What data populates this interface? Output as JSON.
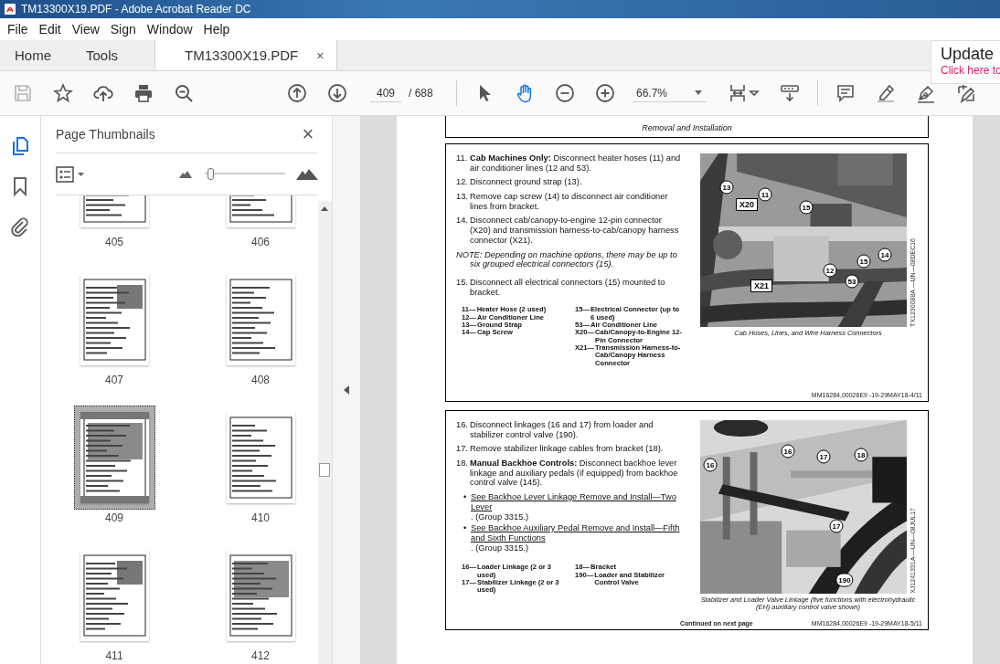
{
  "window": {
    "title": "TM13300X19.PDF - Adobe Acrobat Reader DC"
  },
  "menu": [
    "File",
    "Edit",
    "View",
    "Sign",
    "Window",
    "Help"
  ],
  "tabs": [
    {
      "label": "Home",
      "selected": false
    },
    {
      "label": "Tools",
      "selected": false
    },
    {
      "label": "TM13300X19.PDF",
      "selected": true,
      "close": "×"
    }
  ],
  "update_popup": {
    "title": "Update",
    "link": "Click here to"
  },
  "toolbar": {
    "save": {
      "disabled": true
    },
    "page_number": "409",
    "page_count": "/ 688",
    "pointer_tools": [
      {
        "kind": "select",
        "selected": false
      },
      {
        "kind": "hand",
        "selected": true
      }
    ],
    "zoom": "66.7%"
  },
  "sidebar": {
    "rail": [
      {
        "kind": "pages",
        "selected": true
      },
      {
        "kind": "bookmarks",
        "selected": false
      },
      {
        "kind": "attachments",
        "selected": false
      }
    ],
    "title": "Page Thumbnails",
    "close": "×",
    "thumbnail_size": {
      "level": 0.03
    },
    "thumbnails": [
      {
        "label": "405",
        "selected": false
      },
      {
        "label": "406",
        "selected": false
      },
      {
        "label": "407",
        "selected": false
      },
      {
        "label": "408",
        "selected": false
      },
      {
        "label": "409",
        "selected": true
      },
      {
        "label": "410",
        "selected": false
      },
      {
        "label": "411",
        "selected": false
      },
      {
        "label": "412",
        "selected": false
      }
    ]
  },
  "document": {
    "header": "Removal and Installation",
    "sections": [
      {
        "items": [
          {
            "kind": "step",
            "number": "11.",
            "text": "**Cab Machines Only:** Disconnect heater hoses (11) and air conditioner lines (12 and 53)."
          },
          {
            "kind": "step",
            "number": "12.",
            "text": "Disconnect ground strap (13)."
          },
          {
            "kind": "step",
            "number": "13.",
            "text": "Remove cap screw (14) to disconnect air conditioner lines from bracket."
          },
          {
            "kind": "step",
            "number": "14.",
            "text": "Disconnect cab/canopy-to-engine 12-pin connector (X20) and transmission harness-to-cab/canopy harness connector (X21)."
          },
          {
            "kind": "note",
            "text": "NOTE: Depending on machine options, there may be up to six grouped electrical connectors (15)."
          },
          {
            "kind": "step",
            "number": "15.",
            "text": "Disconnect all electrical connectors (15) mounted to bracket."
          }
        ],
        "legend": [
          [
            {
              "key": "11—",
              "text": "Heater Hose (2 used)"
            },
            {
              "key": "12—",
              "text": "Air Conditioner Line"
            },
            {
              "key": "13—",
              "text": "Ground Strap"
            },
            {
              "key": "14—",
              "text": "Cap Screw"
            }
          ],
          [
            {
              "key": "15—",
              "text": "Electrical Connector (up to 6 used)"
            },
            {
              "key": "53—",
              "text": "Air Conditioner Line"
            },
            {
              "key": "X20—",
              "text": "Cab/Canopy-to-Engine 12-Pin Connector"
            },
            {
              "key": "X21—",
              "text": "Transmission Harness-to-Cab/Canopy Harness Connector"
            }
          ]
        ],
        "figure": {
          "kind": "picture",
          "callouts": [
            {
              "label": "13",
              "kind": "circle"
            },
            {
              "label": "X20",
              "kind": "box"
            },
            {
              "label": "11",
              "kind": "circle"
            },
            {
              "label": "15",
              "kind": "circle"
            },
            {
              "label": "15",
              "kind": "circle"
            },
            {
              "label": "14",
              "kind": "circle"
            },
            {
              "label": "12",
              "kind": "circle"
            },
            {
              "label": "53",
              "kind": "circle"
            },
            {
              "label": "X21",
              "kind": "box"
            }
          ],
          "caption": "Cab Hoses, Lines, and Wire Harness Connectors",
          "side_code": "TX1230088A —UN—08DEC16"
        },
        "footer_code": "MM16284,00026E9 -19-29MAY18-4/11"
      },
      {
        "items": [
          {
            "kind": "step",
            "number": "16.",
            "text": "Disconnect linkages (16 and 17) from loader and stabilizer control valve (190)."
          },
          {
            "kind": "step",
            "number": "17.",
            "text": "Remove stabilizer linkage cables from bracket (18)."
          },
          {
            "kind": "step",
            "number": "18.",
            "text": "**Manual Backhoe Controls:** Disconnect backhoe lever linkage and auxiliary pedals (if equipped) from backhoe control valve (145)."
          },
          {
            "kind": "bullet",
            "symbol": "•",
            "link": "See Backhoe Lever Linkage Remove and Install—Two Lever",
            "text": ". (Group 3315.)"
          },
          {
            "kind": "bullet",
            "symbol": "•",
            "link": "See Backhoe Auxiliary Pedal Remove and Install—Fifth and Sixth Functions",
            "text": ". (Group 3315.)"
          }
        ],
        "legend": [
          [
            {
              "key": "16—",
              "text": "Loader Linkage (2 or 3 used)"
            },
            {
              "key": "17—",
              "text": "Stabilizer Linkage (2 or 3 used)"
            }
          ],
          [
            {
              "key": "18—",
              "text": "Bracket"
            },
            {
              "key": "190—",
              "text": "Loader and Stabilizer Control Valve"
            }
          ]
        ],
        "figure": {
          "kind": "picture",
          "callouts": [
            {
              "label": "16",
              "kind": "circle"
            },
            {
              "label": "16",
              "kind": "circle"
            },
            {
              "label": "17",
              "kind": "circle"
            },
            {
              "label": "18",
              "kind": "circle"
            },
            {
              "label": "17",
              "kind": "circle"
            },
            {
              "label": "190",
              "kind": "circle"
            }
          ],
          "caption": "Stabilizer and Loader Valve Linkage (five functions with electrohydraulic (EH) auxiliary control valve shown)",
          "side_code": "XJ1241331A —UN—08JUL17"
        },
        "footer_left": "Continued on next page",
        "footer_code": "MM16284,00026E9 -19-29MAY18-5/11"
      }
    ]
  }
}
